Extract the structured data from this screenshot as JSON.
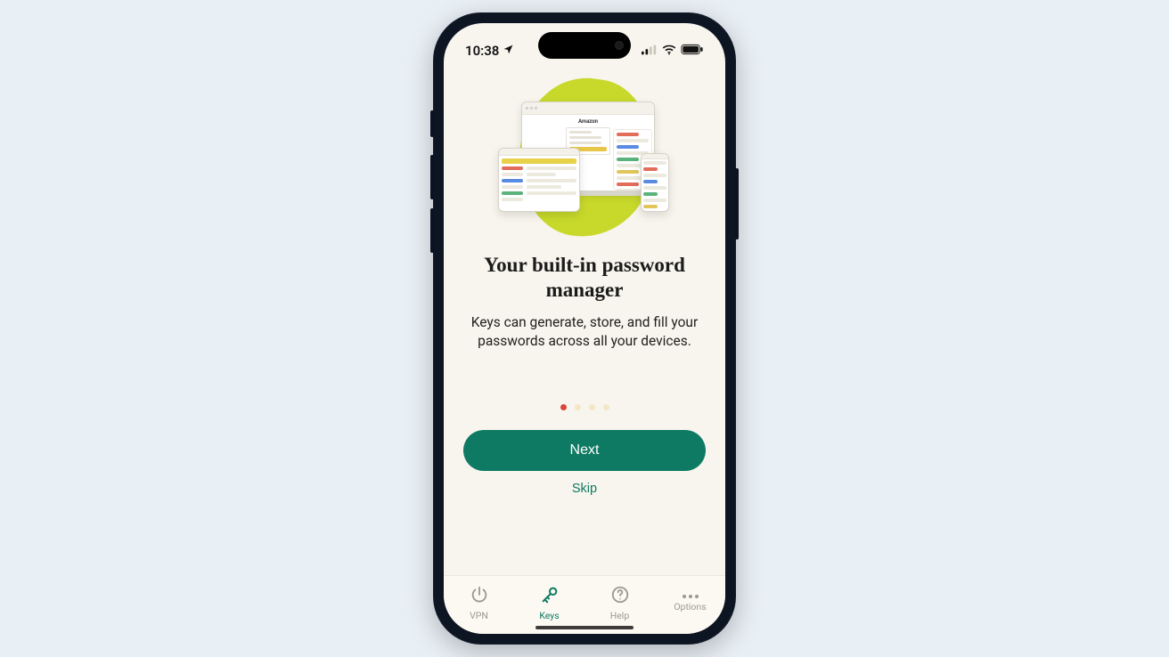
{
  "status": {
    "time": "10:38"
  },
  "onboarding": {
    "title": "Your built-in password manager",
    "subtitle": "Keys can generate, store, and fill your passwords across all your devices.",
    "illustration_page_label": "Amazon",
    "page_count": 4,
    "current_page": 1,
    "next_label": "Next",
    "skip_label": "Skip"
  },
  "tabs": [
    {
      "id": "vpn",
      "label": "VPN",
      "icon": "power-icon",
      "active": false
    },
    {
      "id": "keys",
      "label": "Keys",
      "icon": "key-icon",
      "active": true
    },
    {
      "id": "help",
      "label": "Help",
      "icon": "help-icon",
      "active": false
    },
    {
      "id": "options",
      "label": "Options",
      "icon": "more-icon",
      "active": false
    }
  ],
  "colors": {
    "accent": "#0f7a63",
    "blob": "#c8d92b",
    "dot_active": "#d9463a",
    "bg": "#f8f5ee"
  }
}
